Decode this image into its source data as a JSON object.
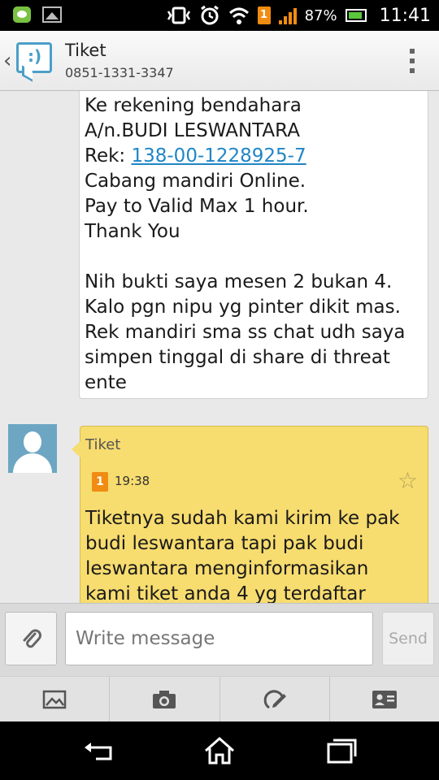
{
  "status_bar": {
    "battery": "87%",
    "time": "11:41",
    "sim_label": "1",
    "icons": [
      "line-app-icon",
      "image-notification-icon",
      "vibrate-icon",
      "alarm-icon",
      "wifi-icon",
      "sim-icon",
      "signal-icon",
      "battery-icon"
    ]
  },
  "header": {
    "contact_name": "Tiket",
    "contact_number": "0851-1331-3347",
    "icons": [
      "back-chevron-icon",
      "messaging-app-icon",
      "overflow-menu-icon"
    ]
  },
  "messages": {
    "outgoing": {
      "lines": [
        "Ke rekening bendahara",
        "A/n.BUDI LESWANTARA",
        "Rek: ",
        "Cabang mandiri Online.",
        "Pay to Valid Max 1 hour.",
        "Thank You",
        "",
        "Nih bukti saya mesen 2 bukan 4.",
        "Kalo pgn nipu yg pinter dikit mas.",
        "Rek mandiri sma ss chat udh saya",
        "simpen tinggal di share di threat",
        "ente"
      ],
      "account_link": "138-00-1228925-7"
    },
    "incoming": {
      "sender": "Tiket",
      "sim_label": "1",
      "time": "19:38",
      "lines": [
        "Tiketnya sudah kami kirim ke pak",
        "budi leswantara tapi pak budi",
        "leswantara menginformasikan",
        "kami tiket anda 4 yg terdaftar"
      ]
    }
  },
  "composer": {
    "placeholder": "Write message",
    "send_label": "Send"
  },
  "toolbar": {
    "items": [
      "gallery-icon",
      "camera-icon",
      "sketch-icon",
      "contact-card-icon"
    ]
  },
  "nav": {
    "items": [
      "back-icon",
      "home-icon",
      "recent-apps-icon"
    ]
  },
  "colors": {
    "incoming_bubble": "#f7dc6f",
    "link": "#1f86c6",
    "accent_orange": "#f08c12"
  }
}
